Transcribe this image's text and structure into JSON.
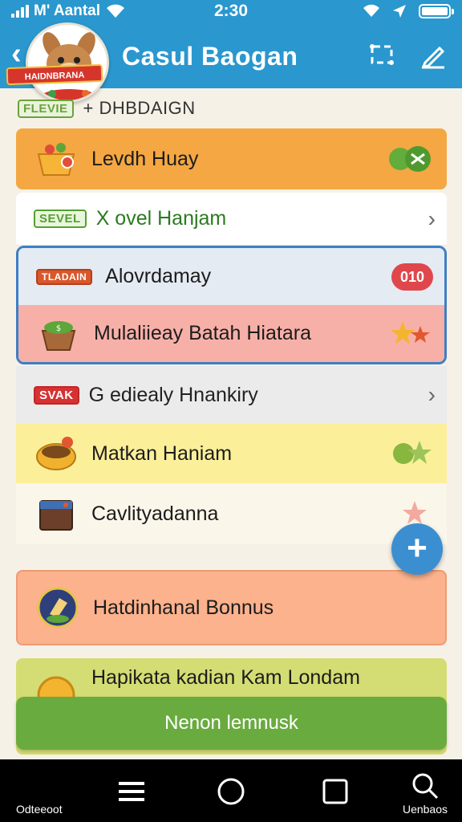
{
  "status_bar": {
    "carrier": "M' Aantal",
    "time": "2:30"
  },
  "app_bar": {
    "title": "Casul Baogan",
    "mascot_banner": "HAIDNBRANA"
  },
  "section": {
    "chip": "FLEVIE",
    "breadcrumb": "+ DHBDAIGN"
  },
  "rows": [
    {
      "label": "Levdh Huay",
      "bg": "#f4a742"
    },
    {
      "chip": "SEVEL",
      "label": "X ovel Hanjam",
      "bg": "#ffffff"
    },
    {
      "chip": "TLADAIN",
      "label": "Alovrdamay",
      "badge": "010",
      "bg": "#e5ebf3"
    },
    {
      "label": "Mulaliieay Batah Hiatara",
      "bg": "#f7b0a8"
    },
    {
      "chip": "SVAK",
      "label": "G ediealy Hnankiry",
      "bg": "#ebebeb"
    },
    {
      "label": "Matkan Haniam",
      "bg": "#fbef9a"
    },
    {
      "label": "Cavlityadanna",
      "bg": "#fbf6ea"
    },
    {
      "label": "Hatdinhanal Bonnus",
      "bg": "#fbb28d"
    },
    {
      "label": "Hapikata kadian Kam Londam",
      "bg": "#d4dd74"
    }
  ],
  "primary_button": {
    "label": "Nenon lemnusk"
  },
  "nav_bar": {
    "left_label": "Odteeoot",
    "right_label": "Uenbaos"
  },
  "colors": {
    "brand_blue": "#2a97cf",
    "accent_green": "#6aab3f",
    "fab_blue": "#3b8fd1"
  }
}
